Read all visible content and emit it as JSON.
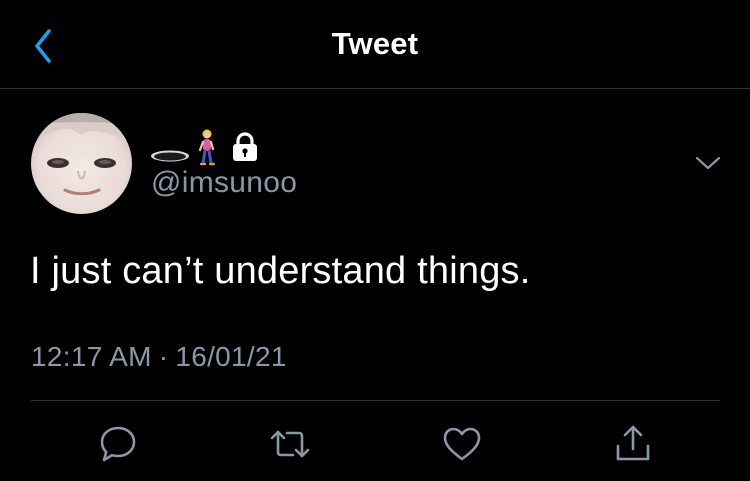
{
  "nav": {
    "title": "Tweet",
    "back_icon": "chevron-left-icon",
    "accent_color": "#1da1f2"
  },
  "author": {
    "name_emojis": [
      "hole-emoji",
      "woman-walking-emoji",
      "lock-emoji"
    ],
    "protected": true,
    "handle": "@imsunoo"
  },
  "tweet": {
    "text": "I just can’t understand things.",
    "time": "12:17 AM",
    "separator": "·",
    "date": "16/01/21"
  },
  "actions": [
    {
      "name": "reply",
      "icon": "reply-icon"
    },
    {
      "name": "retweet",
      "icon": "retweet-icon"
    },
    {
      "name": "like",
      "icon": "heart-icon"
    },
    {
      "name": "share",
      "icon": "share-icon"
    }
  ],
  "colors": {
    "background": "#000000",
    "text": "#ffffff",
    "secondary_text": "#8899a6",
    "divider": "#2f3336"
  }
}
